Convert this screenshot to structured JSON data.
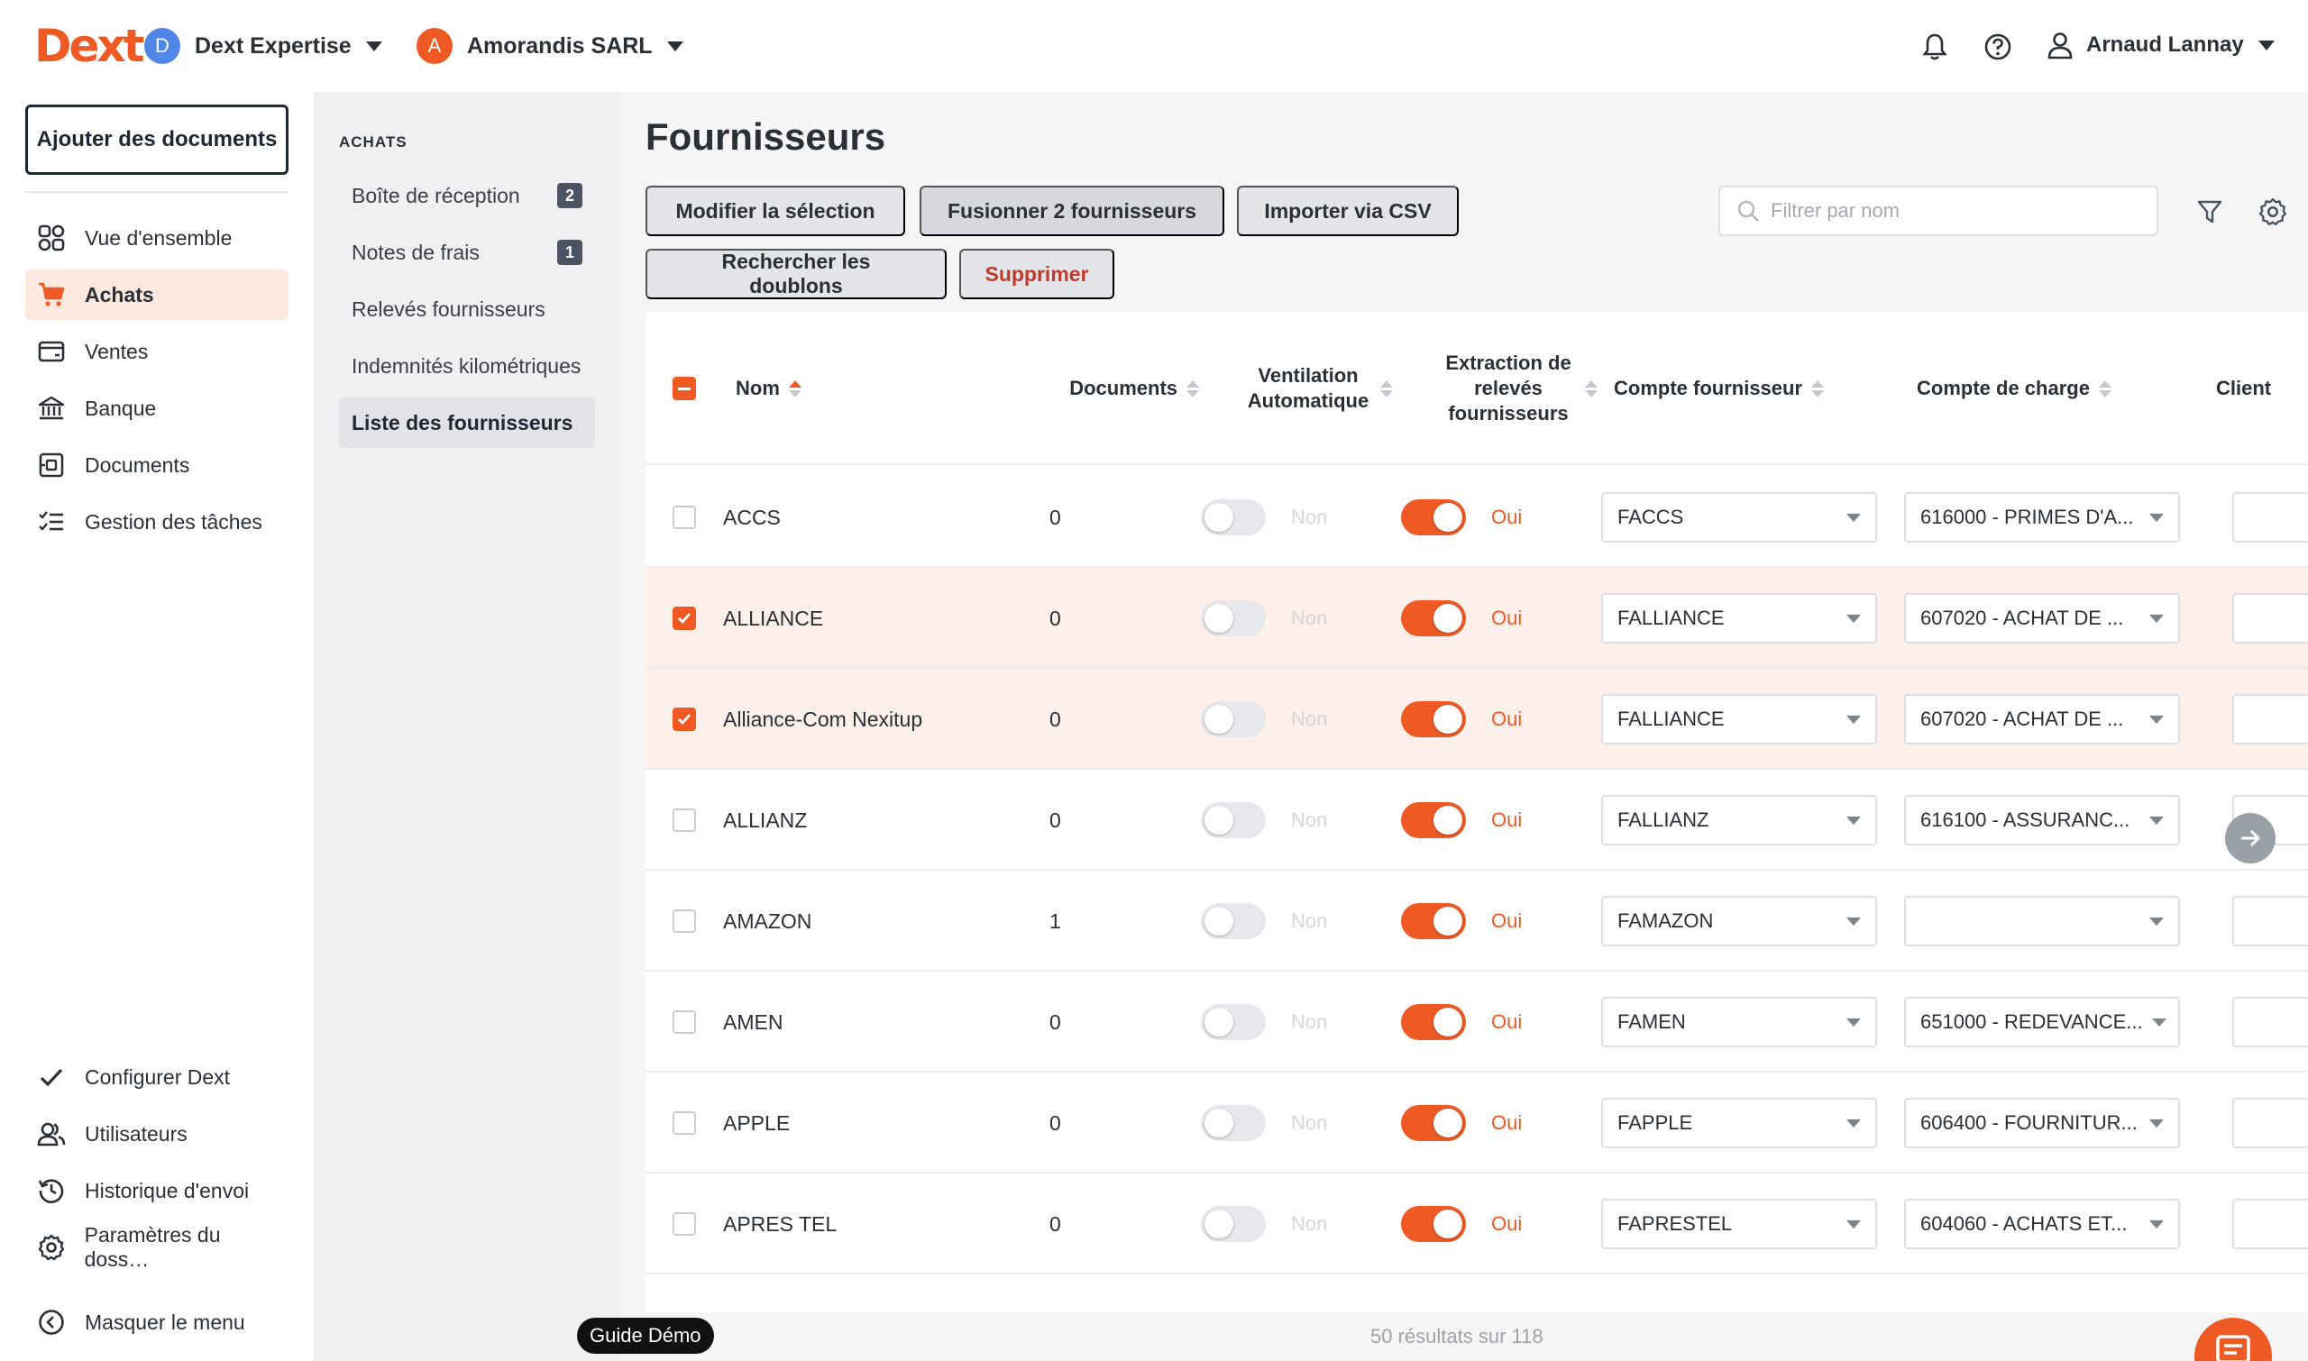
{
  "brand": {
    "logo": "Dext",
    "accent": "#ef5a24"
  },
  "topbar": {
    "org1": {
      "initial": "D",
      "name": "Dext Expertise",
      "color": "#4f86e8"
    },
    "org2": {
      "initial": "A",
      "name": "Amorandis SARL",
      "color": "#ef5a24"
    },
    "user_name": "Arnaud Lannay"
  },
  "leftnav": {
    "add_button": "Ajouter des documents",
    "items": [
      {
        "label": "Vue d'ensemble",
        "icon": "dashboard-icon"
      },
      {
        "label": "Achats",
        "icon": "cart-icon"
      },
      {
        "label": "Ventes",
        "icon": "wallet-icon"
      },
      {
        "label": "Banque",
        "icon": "bank-icon"
      },
      {
        "label": "Documents",
        "icon": "documents-icon"
      },
      {
        "label": "Gestion des tâches",
        "icon": "tasks-icon"
      }
    ],
    "bottom_items": [
      {
        "label": "Configurer Dext",
        "icon": "check-icon"
      },
      {
        "label": "Utilisateurs",
        "icon": "users-icon"
      },
      {
        "label": "Historique d'envoi",
        "icon": "history-icon"
      },
      {
        "label": "Paramètres du doss…",
        "icon": "gear-icon"
      }
    ],
    "hide_menu": "Masquer le menu"
  },
  "subnav": {
    "title": "ACHATS",
    "items": [
      {
        "label": "Boîte de réception",
        "count": "2"
      },
      {
        "label": "Notes de frais",
        "count": "1"
      },
      {
        "label": "Relevés fournisseurs",
        "count": ""
      },
      {
        "label": "Indemnités kilométriques",
        "count": ""
      },
      {
        "label": "Liste des fournisseurs",
        "count": ""
      }
    ]
  },
  "main": {
    "title": "Fournisseurs",
    "buttons": {
      "modify": "Modifier la sélection",
      "merge": "Fusionner 2 fournisseurs",
      "import": "Importer via CSV",
      "duplicates": "Rechercher les doublons",
      "delete": "Supprimer"
    },
    "filter_placeholder": "Filtrer par nom",
    "columns": {
      "name": "Nom",
      "documents": "Documents",
      "ventilation": "Ventilation Automatique",
      "extraction": "Extraction de relevés fournisseurs",
      "supplier_account": "Compte fournisseur",
      "charge_account": "Compte de charge",
      "client": "Client"
    },
    "rows": [
      {
        "selected": false,
        "name": "ACCS",
        "documents": "0",
        "ventilation": "Non",
        "extraction": "Oui",
        "supplier_account": "FACCS",
        "charge_account": "616000 - PRIMES D'A..."
      },
      {
        "selected": true,
        "name": "ALLIANCE",
        "documents": "0",
        "ventilation": "Non",
        "extraction": "Oui",
        "supplier_account": "FALLIANCE",
        "charge_account": "607020 - ACHAT DE ..."
      },
      {
        "selected": true,
        "name": "Alliance-Com Nexitup",
        "documents": "0",
        "ventilation": "Non",
        "extraction": "Oui",
        "supplier_account": "FALLIANCE",
        "charge_account": "607020 - ACHAT DE ..."
      },
      {
        "selected": false,
        "name": "ALLIANZ",
        "documents": "0",
        "ventilation": "Non",
        "extraction": "Oui",
        "supplier_account": "FALLIANZ",
        "charge_account": "616100 - ASSURANC..."
      },
      {
        "selected": false,
        "name": "AMAZON",
        "documents": "1",
        "ventilation": "Non",
        "extraction": "Oui",
        "supplier_account": "FAMAZON",
        "charge_account": ""
      },
      {
        "selected": false,
        "name": "AMEN",
        "documents": "0",
        "ventilation": "Non",
        "extraction": "Oui",
        "supplier_account": "FAMEN",
        "charge_account": "651000 - REDEVANCE..."
      },
      {
        "selected": false,
        "name": "APPLE",
        "documents": "0",
        "ventilation": "Non",
        "extraction": "Oui",
        "supplier_account": "FAPPLE",
        "charge_account": "606400 - FOURNITUR..."
      },
      {
        "selected": false,
        "name": "APRES TEL",
        "documents": "0",
        "ventilation": "Non",
        "extraction": "Oui",
        "supplier_account": "FAPRESTEL",
        "charge_account": "604060 - ACHATS ET..."
      }
    ],
    "results": "50 résultats sur 118",
    "guide": "Guide Démo"
  }
}
